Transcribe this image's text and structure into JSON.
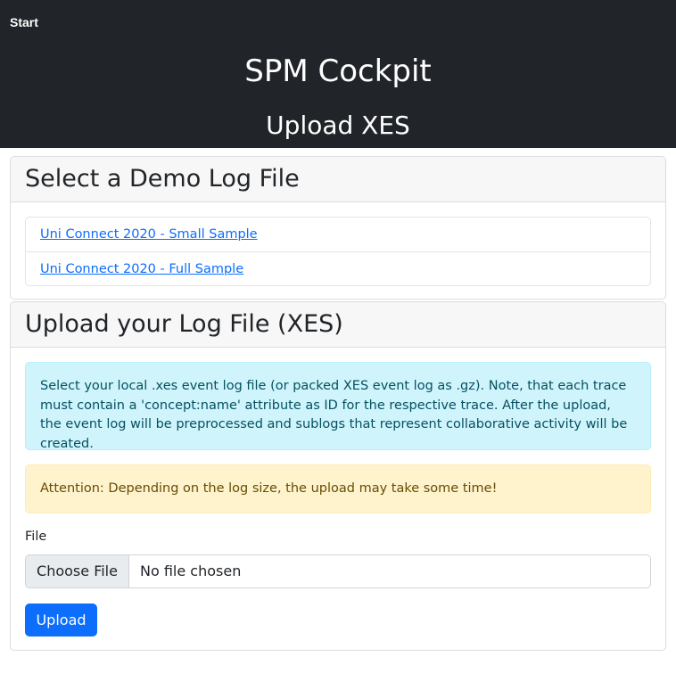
{
  "nav": {
    "start_label": "Start"
  },
  "header": {
    "app_title": "SPM Cockpit",
    "page_subtitle": "Upload XES"
  },
  "demo_card": {
    "title": "Select a Demo Log File",
    "items": [
      {
        "label": "Uni Connect 2020 - Small Sample"
      },
      {
        "label": "Uni Connect 2020 - Full Sample"
      }
    ]
  },
  "upload_card": {
    "title": "Upload your Log File (XES)",
    "info_text": "Select your local .xes event log file (or packed XES event log as .gz). Note, that each trace must contain a 'concept:name' attribute as ID for the respective trace. After the upload, the event log will be preprocessed and sublogs that represent collaborative activity will be created.",
    "warning_text": "Attention: Depending on the log size, the upload may take some time!",
    "file_label": "File",
    "choose_file_label": "Choose File",
    "no_file_text": "No file chosen",
    "upload_label": "Upload"
  },
  "colors": {
    "topbar": "#212529",
    "link": "#0d6efd",
    "primary": "#0d6efd",
    "info_bg": "#cff4fc",
    "warning_bg": "#fff3cd"
  }
}
